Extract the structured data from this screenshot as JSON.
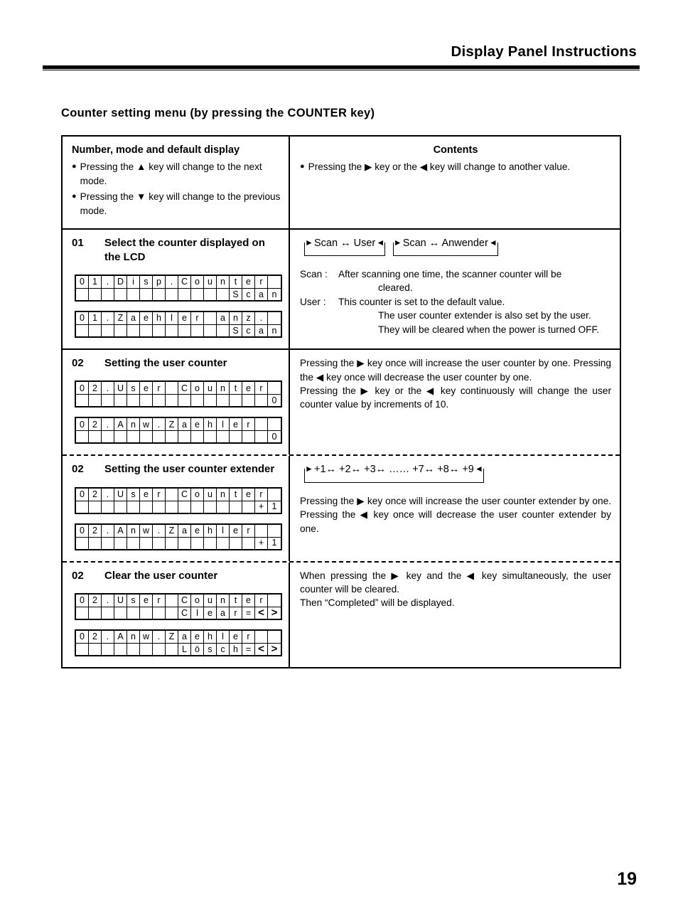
{
  "header": {
    "title": "Display Panel Instructions"
  },
  "section_heading": "Counter setting menu (by pressing the COUNTER key)",
  "page_number": "19",
  "table": {
    "header_row": {
      "left_title": "Number, mode and default display",
      "left_bullets": [
        "Pressing the ▲ key will change to the next mode.",
        "Pressing the ▼ key will change to the previous mode."
      ],
      "right_title": "Contents",
      "right_bullets": [
        "Pressing the ▶ key or the ◀ key will change to another value."
      ]
    },
    "rows": [
      {
        "number": "01",
        "label": "Select the counter displayed on the LCD",
        "lcds": [
          {
            "name": "lcd-01-english",
            "line1": "01.Disp.Counter ",
            "line2": "            Scan"
          },
          {
            "name": "lcd-01-german",
            "line1": "01.Zaehler anz. ",
            "line2": "            Scan"
          }
        ],
        "loops": [
          {
            "name": "loop-scan-user",
            "text": "Scan ↔ User"
          },
          {
            "name": "loop-scan-anwender",
            "text": "Scan ↔ Anwender"
          }
        ],
        "definitions": [
          {
            "key": "Scan :",
            "lines": [
              "After scanning one time, the scanner counter will be",
              "cleared."
            ]
          },
          {
            "key": "User :",
            "lines": [
              "This counter is set to the default value.",
              "The user counter extender is also set by the user.",
              "They will be cleared when the power is turned OFF."
            ]
          }
        ],
        "divider_below": "dashed"
      },
      {
        "number": "02",
        "label": "Setting the user counter",
        "lcds": [
          {
            "name": "lcd-02-user-counter-english",
            "line1": "02.User Counter ",
            "line2": "               0"
          },
          {
            "name": "lcd-02-user-counter-german",
            "line1": "02.Anw.Zaehler  ",
            "line2": "               0"
          }
        ],
        "paragraphs": [
          "Pressing the ▶ key once will increase the user counter by one. Pressing the ◀ key once will decrease the user counter by one.",
          "Pressing the ▶ key or the ◀ key continuously will change the user counter value by increments of 10."
        ],
        "divider_below": "dashed"
      },
      {
        "number": "02",
        "label": "Setting the user counter extender",
        "lcds": [
          {
            "name": "lcd-02-extender-english",
            "line1": "02.User Counter ",
            "line2": "              +1"
          },
          {
            "name": "lcd-02-extender-german",
            "line1": "02.Anw.Zaehler  ",
            "line2": "              +1"
          }
        ],
        "loops": [
          {
            "name": "loop-extender-range",
            "text": "+1↔ +2↔ +3↔ …… +7↔ +8↔ +9"
          }
        ],
        "paragraphs": [
          "Pressing the ▶ key once will increase the user counter extender by one. Pressing the ◀ key once will decrease the user counter extender by one."
        ],
        "divider_below": "dashed"
      },
      {
        "number": "02",
        "label": "Clear the user counter",
        "lcds": [
          {
            "name": "lcd-02-clear-english",
            "line1": "02.User Counter ",
            "line2": "        Clear=<>"
          },
          {
            "name": "lcd-02-clear-german",
            "line1": "02.Anw.Zaehler  ",
            "line2": "        Lösch=<>"
          }
        ],
        "paragraphs": [
          "When pressing the ▶ key and the ◀ key simultaneously, the user counter will be cleared.",
          "Then “Completed” will be displayed."
        ],
        "divider_below": "none"
      }
    ]
  }
}
